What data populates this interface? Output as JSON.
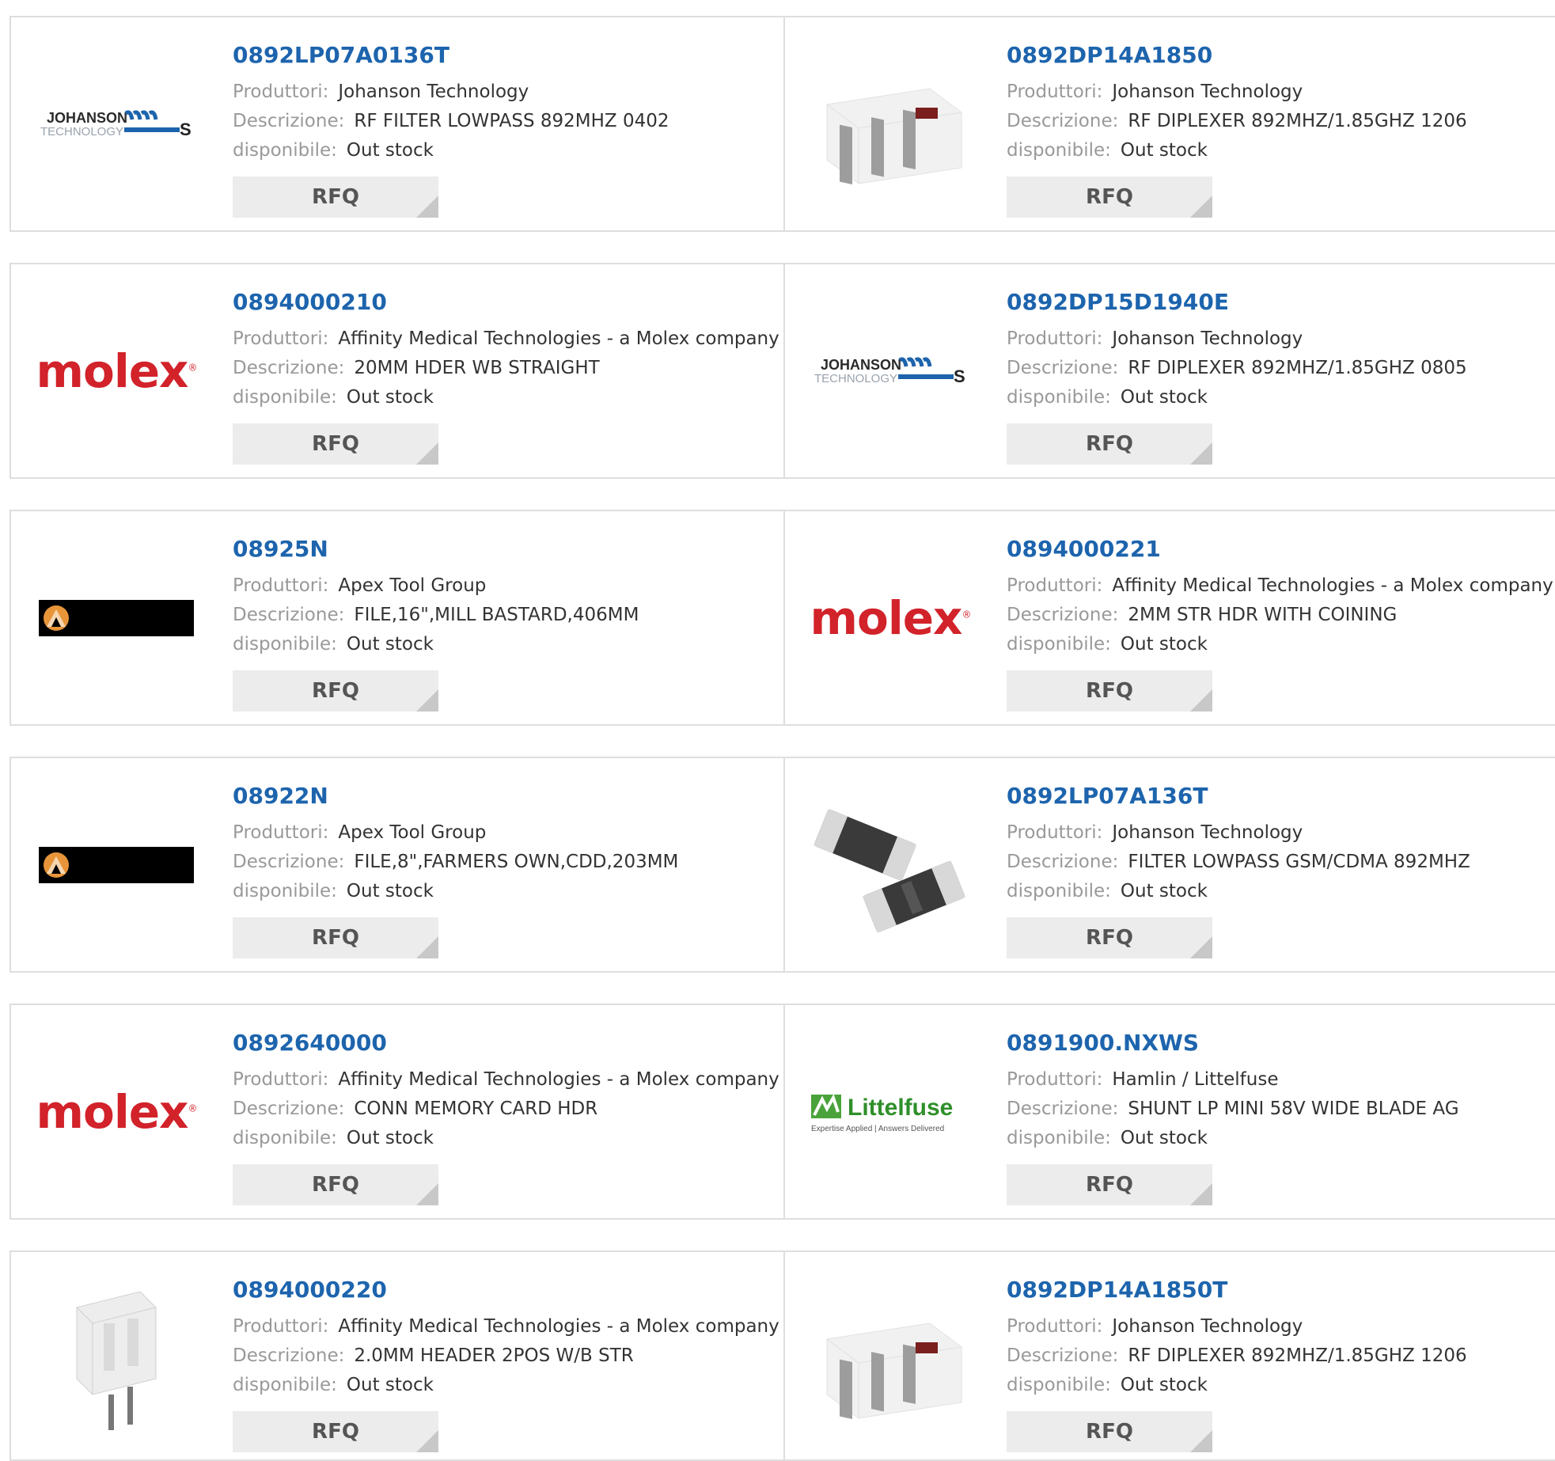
{
  "labels": {
    "manufacturer": "Produttori:",
    "description": "Descrizione:",
    "availability": "disponibile:",
    "rfq": "RFQ"
  },
  "colors": {
    "link": "#1d64ad",
    "label": "#999999",
    "value": "#333333",
    "rfq_bg": "#ececec",
    "molex_red": "#d2222a"
  },
  "logos": {
    "johanson_line1": "JOHANSON",
    "johanson_line2": "TECHNOLOGY",
    "molex": "molex",
    "littelfuse": "Littelfuse",
    "littelfuse_tagline": "Expertise Applied | Answers Delivered"
  },
  "products": [
    {
      "part": "0892LP07A0136T",
      "manufacturer": "Johanson Technology",
      "description": "RF FILTER LOWPASS 892MHZ 0402",
      "availability": "Out stock",
      "image": "johanson-logo"
    },
    {
      "part": "0892DP14A1850",
      "manufacturer": "Johanson Technology",
      "description": "RF DIPLEXER 892MHZ/1.85GHZ 1206",
      "availability": "Out stock",
      "image": "diplexer-chip-photo"
    },
    {
      "part": "0894000210",
      "manufacturer": "Affinity Medical Technologies - a Molex company",
      "description": "20MM HDER WB STRAIGHT",
      "availability": "Out stock",
      "image": "molex-logo"
    },
    {
      "part": "0892DP15D1940E",
      "manufacturer": "Johanson Technology",
      "description": "RF DIPLEXER 892MHZ/1.85GHZ 0805",
      "availability": "Out stock",
      "image": "johanson-logo"
    },
    {
      "part": "08925N",
      "manufacturer": "Apex Tool Group",
      "description": "FILE,16\",MILL BASTARD,406MM",
      "availability": "Out stock",
      "image": "apex-logo"
    },
    {
      "part": "0894000221",
      "manufacturer": "Affinity Medical Technologies - a Molex company",
      "description": "2MM STR HDR WITH COINING",
      "availability": "Out stock",
      "image": "molex-logo"
    },
    {
      "part": "08922N",
      "manufacturer": "Apex Tool Group",
      "description": "FILE,8\",FARMERS OWN,CDD,203MM",
      "availability": "Out stock",
      "image": "apex-logo"
    },
    {
      "part": "0892LP07A136T",
      "manufacturer": "Johanson Technology",
      "description": "FILTER LOWPASS GSM/CDMA 892MHZ",
      "availability": "Out stock",
      "image": "filter-chips-photo"
    },
    {
      "part": "0892640000",
      "manufacturer": "Affinity Medical Technologies - a Molex company",
      "description": "CONN MEMORY CARD HDR",
      "availability": "Out stock",
      "image": "molex-logo"
    },
    {
      "part": "0891900.NXWS",
      "manufacturer": "Hamlin / Littelfuse",
      "description": "SHUNT LP MINI 58V WIDE BLADE AG",
      "availability": "Out stock",
      "image": "littelfuse-logo"
    },
    {
      "part": "0894000220",
      "manufacturer": "Affinity Medical Technologies - a Molex company",
      "description": "2.0MM HEADER 2POS W/B STR",
      "availability": "Out stock",
      "image": "header-connector-photo"
    },
    {
      "part": "0892DP14A1850T",
      "manufacturer": "Johanson Technology",
      "description": "RF DIPLEXER 892MHZ/1.85GHZ 1206",
      "availability": "Out stock",
      "image": "diplexer-chip-photo"
    }
  ]
}
